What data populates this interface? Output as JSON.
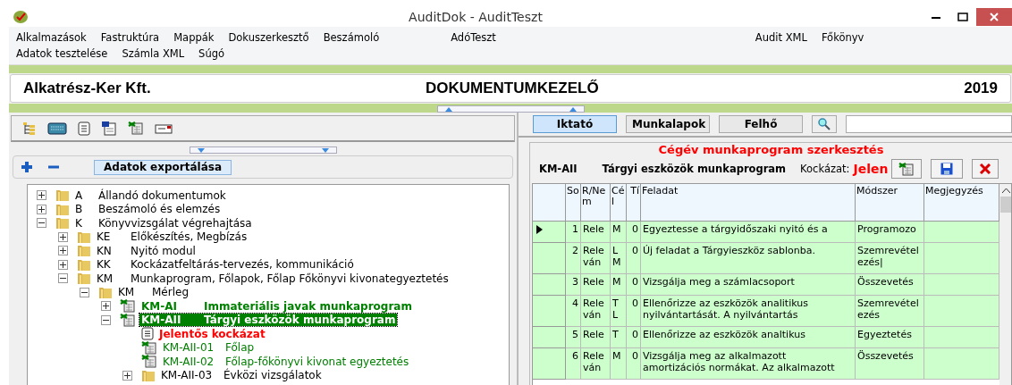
{
  "window": {
    "title": "AuditDok - AuditTeszt"
  },
  "menu": {
    "rows": [
      {
        "left": [
          "Alkalmazások",
          "Fastruktúra",
          "Mappák",
          "Dokuszerkesztő",
          "Beszámoló"
        ],
        "middle": [
          "AdóTeszt"
        ],
        "right": [
          "Audit XML",
          "Főkönyv"
        ]
      },
      {
        "left": [
          "Adatok tesztelése",
          "Számla XML",
          "Súgó"
        ],
        "middle": [],
        "right": []
      }
    ]
  },
  "header": {
    "company": "Alkatrész-Ker Kft.",
    "title": "DOKUMENTUMKEZELŐ",
    "year": "2019"
  },
  "tree_actions": {
    "export_button": "Adatok exportálása"
  },
  "tree": [
    {
      "kind": "folder",
      "code": "A",
      "label": "Állandó dokumentumok",
      "expanded": false,
      "selected": false,
      "color": "#000000",
      "bold": false
    },
    {
      "kind": "folder",
      "code": "B",
      "label": "Beszámoló és elemzés",
      "expanded": false,
      "selected": false,
      "color": "#000000",
      "bold": false
    },
    {
      "kind": "folder",
      "code": "K",
      "label": "Könyvvizsgálat végrehajtása",
      "expanded": true,
      "selected": false,
      "color": "#000000",
      "bold": false,
      "children": [
        {
          "kind": "folder",
          "code": "KE",
          "label": "Előkészítés, Megbízás",
          "expanded": false,
          "selected": false,
          "color": "#000000",
          "bold": false
        },
        {
          "kind": "folder",
          "code": "KN",
          "label": "Nyitó modul",
          "expanded": false,
          "selected": false,
          "color": "#000000",
          "bold": false
        },
        {
          "kind": "folder",
          "code": "KK",
          "label": "Kockázatfeltárás-tervezés, kommunikáció",
          "expanded": false,
          "selected": false,
          "color": "#000000",
          "bold": false
        },
        {
          "kind": "folder",
          "code": "KM",
          "label": "Munkaprogram, Főlapok, Főlap Főkönyvi kivonategyeztetés",
          "expanded": true,
          "selected": false,
          "color": "#000000",
          "bold": false,
          "children": [
            {
              "kind": "folder",
              "code": "KM",
              "label": "Mérleg",
              "expanded": true,
              "selected": false,
              "color": "#000000",
              "bold": false,
              "children": [
                {
                  "kind": "sheet",
                  "code": "KM-AI",
                  "label": "Immateriális javak munkaprogram",
                  "expanded": false,
                  "selected": false,
                  "color": "#008000",
                  "bold": true
                },
                {
                  "kind": "sheet",
                  "code": "KM-AII",
                  "label": "Tárgyi eszközök munkaprogram",
                  "expanded": true,
                  "selected": true,
                  "color": "#008000",
                  "bold": true,
                  "children": [
                    {
                      "kind": "note",
                      "label": "Jelentős kockázat",
                      "selected": false,
                      "color": "#ff0000",
                      "bold": true
                    },
                    {
                      "kind": "sheet",
                      "code": "KM-AII-01",
                      "label": "Főlap",
                      "selected": false,
                      "color": "#008000",
                      "bold": false
                    },
                    {
                      "kind": "sheet",
                      "code": "KM-AII-02",
                      "label": "Főlap-főkönyvi kivonat egyeztetés",
                      "selected": false,
                      "color": "#008000",
                      "bold": false
                    },
                    {
                      "kind": "folder",
                      "code": "KM-AII-03",
                      "label": "Évközi vizsgálatok",
                      "expanded": false,
                      "selected": false,
                      "color": "#000000",
                      "bold": false
                    }
                  ]
                }
              ]
            }
          ]
        }
      ]
    }
  ],
  "right_tabs": [
    {
      "label": "Iktató",
      "selected": true
    },
    {
      "label": "Munkalapok",
      "selected": false
    },
    {
      "label": "Felhő",
      "selected": false
    }
  ],
  "editor": {
    "title": "Cégév munkaprogram szerkesztés",
    "code": "KM-AII",
    "name": "Tárgyi eszközök munkaprogram",
    "risk_label": "Kockázat:",
    "risk_value": "Jelen"
  },
  "table": {
    "columns": [
      "So",
      "R/Nem",
      "Cél",
      "Tí",
      "Feladat",
      "Módszer",
      "Megjegyzés"
    ],
    "rows": [
      {
        "current": true,
        "cells": [
          "1",
          "Rele",
          "M",
          "0",
          "Egyeztesse a tárgyidőszaki nyitó és a",
          "Programozo",
          ""
        ]
      },
      {
        "current": false,
        "cells": [
          "2",
          "Rele ván",
          "L M",
          "0",
          "Új feladat a Tárgyieszköz sablonba.",
          "Szemrevétel ezés|",
          ""
        ]
      },
      {
        "current": false,
        "cells": [
          "3",
          "Rele",
          "M",
          "0",
          "Vizsgálja meg a számlacsoport",
          "Összevetés",
          ""
        ]
      },
      {
        "current": false,
        "cells": [
          "4",
          "Rele ván",
          "T L",
          "0",
          "Ellenőrizze az eszközök analitikus nyilvántartását. A nyilvántartás",
          "Szemrevétel ezés",
          ""
        ]
      },
      {
        "current": false,
        "cells": [
          "5",
          "Rele",
          "T",
          "0",
          "Ellenőrizze az eszközök analtikus",
          "Egyeztetés",
          ""
        ]
      },
      {
        "current": false,
        "cells": [
          "6",
          "Rele ván",
          "M",
          "0",
          "Vizsgálja meg az alkalmazott amortizációs normákat. Az alkalmazott",
          "Összevetés",
          ""
        ]
      }
    ]
  }
}
